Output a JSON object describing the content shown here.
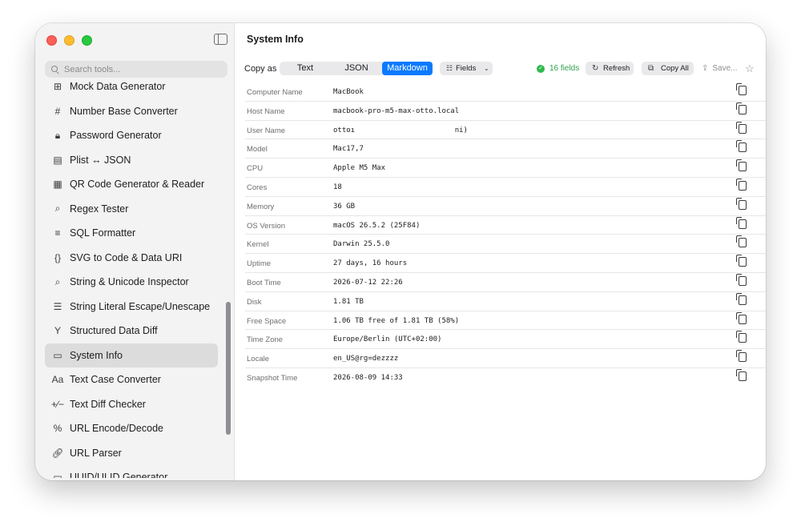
{
  "sidebar": {
    "search_placeholder": "Search tools...",
    "items": [
      {
        "icon": "⊞",
        "icon_name": "table-icon",
        "label": "Mock Data Generator"
      },
      {
        "icon": "#",
        "icon_name": "hash-icon",
        "label": "Number Base Converter"
      },
      {
        "icon": "🔒︎",
        "icon_name": "lock-icon",
        "label": "Password Generator"
      },
      {
        "icon": "▤",
        "icon_name": "list-icon",
        "label": "Plist ↔ JSON"
      },
      {
        "icon": "▦",
        "icon_name": "qrcode-icon",
        "label": "QR Code Generator & Reader"
      },
      {
        "icon": "⌕",
        "icon_name": "magnifier-icon",
        "label": "Regex Tester"
      },
      {
        "icon": "≡",
        "icon_name": "text-align-icon",
        "label": "SQL Formatter"
      },
      {
        "icon": "{}",
        "icon_name": "braces-icon",
        "label": "SVG to Code & Data URI"
      },
      {
        "icon": "⌕",
        "icon_name": "magnifier-icon",
        "label": "String & Unicode Inspector"
      },
      {
        "icon": "☰",
        "icon_name": "text-format-icon",
        "label": "String Literal Escape/Unescape"
      },
      {
        "icon": "Y",
        "icon_name": "branch-icon",
        "label": "Structured Data Diff"
      },
      {
        "icon": "▭",
        "icon_name": "display-icon",
        "label": "System Info",
        "selected": true
      },
      {
        "icon": "Aa",
        "icon_name": "text-case-icon",
        "label": "Text Case Converter"
      },
      {
        "icon": "+∕−",
        "icon_name": "plus-minus-icon",
        "label": "Text Diff Checker"
      },
      {
        "icon": "%",
        "icon_name": "percent-icon",
        "label": "URL Encode/Decode"
      },
      {
        "icon": "🔗︎",
        "icon_name": "link-icon",
        "label": "URL Parser"
      },
      {
        "icon": "▭",
        "icon_name": "uuid-icon",
        "label": "UUID/ULID Generator"
      }
    ]
  },
  "main": {
    "title": "System Info",
    "copy_as_label": "Copy as",
    "formats": [
      "Text",
      "JSON",
      "Markdown"
    ],
    "selected_format": "Markdown",
    "fields_label": "Fields",
    "status_text": "16 fields",
    "refresh_label": "Refresh",
    "copy_all_label": "Copy All",
    "save_label": "Save...",
    "rows": [
      {
        "key": "Computer Name",
        "value": "MacBook"
      },
      {
        "key": "Host Name",
        "value": "macbook-pro-m5-max-otto.local"
      },
      {
        "key": "User Name",
        "value": "ottoı                       ni)"
      },
      {
        "key": "Model",
        "value": "Mac17,7"
      },
      {
        "key": "CPU",
        "value": "Apple M5 Max"
      },
      {
        "key": "Cores",
        "value": "18"
      },
      {
        "key": "Memory",
        "value": "36 GB"
      },
      {
        "key": "OS Version",
        "value": "macOS 26.5.2 (25F84)"
      },
      {
        "key": "Kernel",
        "value": "Darwin 25.5.0"
      },
      {
        "key": "Uptime",
        "value": "27 days, 16 hours"
      },
      {
        "key": "Boot Time",
        "value": "2026-07-12 22:26"
      },
      {
        "key": "Disk",
        "value": "1.81 TB"
      },
      {
        "key": "Free Space",
        "value": "1.06 TB free of 1.81 TB (58%)"
      },
      {
        "key": "Time Zone",
        "value": "Europe/Berlin (UTC+02:00)"
      },
      {
        "key": "Locale",
        "value": "en_US@rg=dezzzz"
      },
      {
        "key": "Snapshot Time",
        "value": "2026-08-09 14:33"
      }
    ]
  },
  "colors": {
    "accent": "#0a7aff",
    "status_green": "#30b94d"
  }
}
